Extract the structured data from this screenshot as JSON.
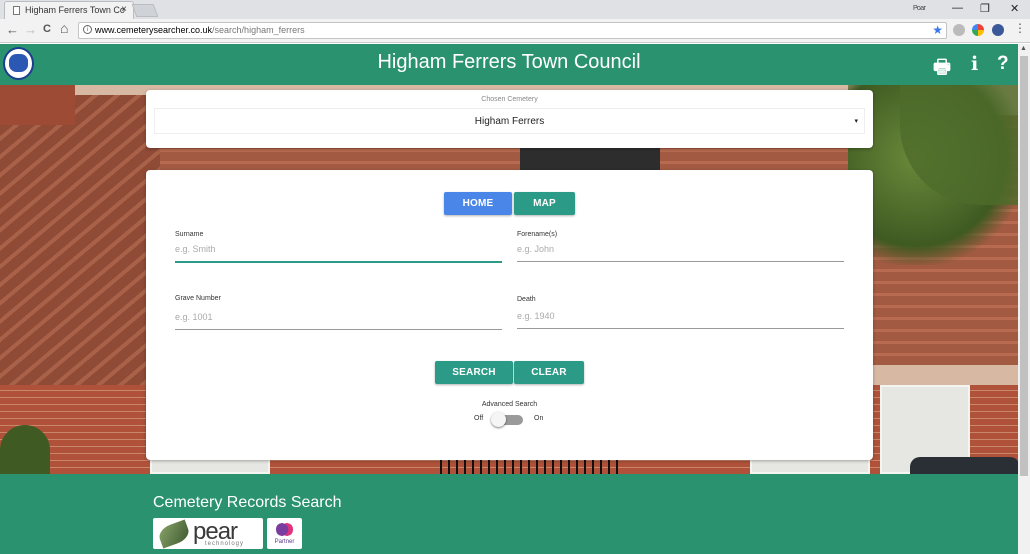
{
  "browser": {
    "tab_title": "Higham Ferrers Town Co",
    "tab_close": "×",
    "url_host": "www.cemeterysearcher.co.uk",
    "url_path": "/search/higham_ferrers",
    "user_label": "Роаг",
    "nav_back": "←",
    "nav_forward": "→",
    "nav_reload": "C",
    "nav_home": "⌂",
    "win_min": "—",
    "win_restore": "❐",
    "win_close": "✕",
    "menu": "⋮"
  },
  "header": {
    "title": "Higham Ferrers Town Council",
    "print_icon": "🖶",
    "info_icon": "i",
    "help_icon": "?"
  },
  "cemetery": {
    "label": "Chosen Cemetery",
    "selected": "Higham Ferrers",
    "caret": "▾"
  },
  "nav_buttons": {
    "home": "HOME",
    "map": "MAP"
  },
  "form": {
    "surname": {
      "label": "Surname",
      "placeholder": "e.g. Smith",
      "value": ""
    },
    "forename": {
      "label": "Forename(s)",
      "placeholder": "e.g. John",
      "value": ""
    },
    "grave": {
      "label": "Grave Number",
      "placeholder": "e.g. 1001",
      "value": ""
    },
    "death": {
      "label": "Death",
      "placeholder": "e.g. 1940",
      "value": ""
    }
  },
  "actions": {
    "search": "SEARCH",
    "clear": "CLEAR"
  },
  "advanced": {
    "label": "Advanced Search",
    "off": "Off",
    "on": "On",
    "state": "off"
  },
  "footer": {
    "title": "Cemetery Records Search",
    "pear_name": "pear",
    "pear_sub": "technology",
    "partner_label": "Partner"
  },
  "colors": {
    "brand_green": "#2b9270",
    "home_blue": "#4a86e8",
    "button_teal": "#2b9a86"
  }
}
